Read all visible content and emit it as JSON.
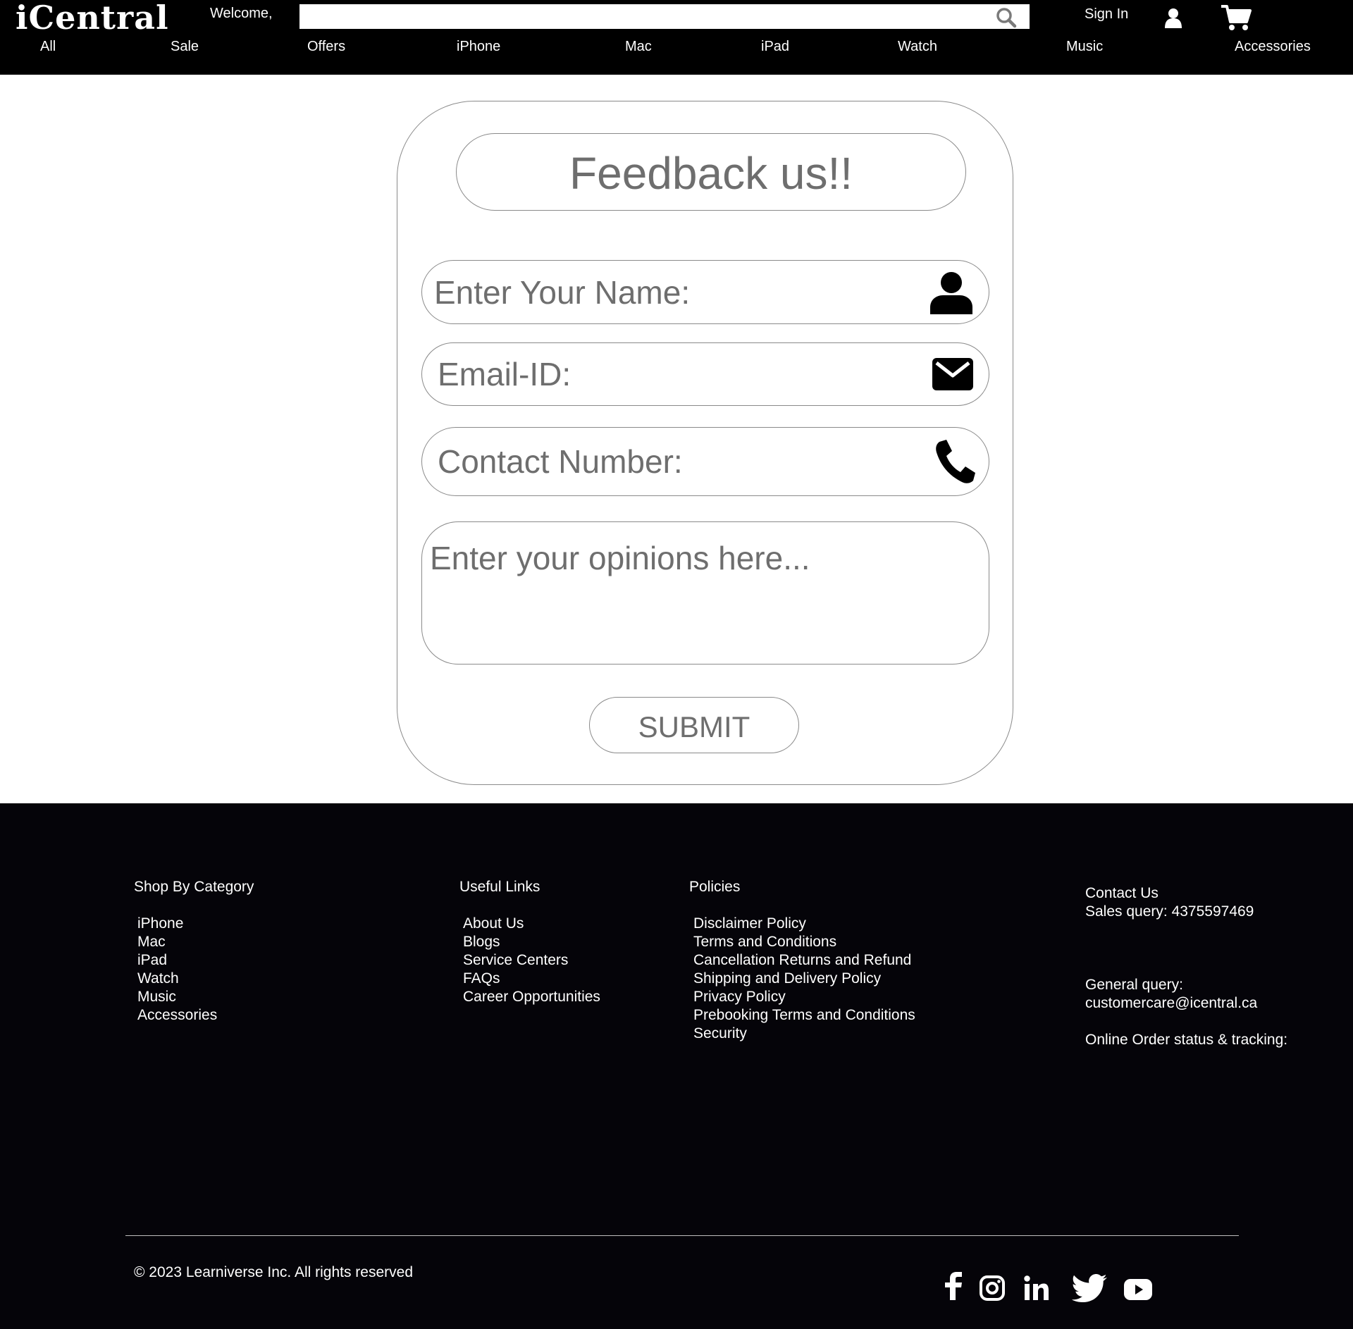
{
  "header": {
    "logo": "iCentral",
    "welcome": "Welcome,",
    "search_value": "",
    "sign_in": "Sign In"
  },
  "nav": [
    "All",
    "Sale",
    "Offers",
    "iPhone",
    "Mac",
    "iPad",
    "Watch",
    "Music",
    "Accessories"
  ],
  "form": {
    "title": "Feedback us!!",
    "name_placeholder": "Enter Your Name:",
    "email_placeholder": "Email-ID:",
    "phone_placeholder": "Contact Number:",
    "opinion_placeholder": "Enter your opinions here...",
    "submit": "SUBMIT"
  },
  "footer": {
    "shop": {
      "heading": "Shop By Category",
      "items": [
        "iPhone",
        "Mac",
        "iPad",
        "Watch",
        "Music",
        "Accessories"
      ]
    },
    "links": {
      "heading": "Useful Links",
      "items": [
        "About Us",
        "Blogs",
        "Service Centers",
        "FAQs",
        "Career Opportunities"
      ]
    },
    "policies": {
      "heading": "Policies",
      "items": [
        "Disclaimer Policy",
        "Terms and Conditions",
        "Cancellation Returns and Refund",
        "Shipping and Delivery Policy",
        "Privacy Policy",
        "Prebooking Terms and Conditions",
        "Security"
      ]
    },
    "contact": {
      "heading": "Contact Us",
      "sales": "Sales query: 4375597469",
      "general_label": "General query:",
      "general_email": "customercare@icentral.ca",
      "tracking": "Online Order status & tracking:"
    },
    "copyright": "© 2023 Learniverse Inc. All rights reserved",
    "social": [
      "facebook-icon",
      "instagram-icon",
      "linkedin-icon",
      "twitter-icon",
      "youtube-icon"
    ]
  },
  "colors": {
    "header_bg": "#000000",
    "footer_bg": "#050409",
    "form_text": "#6e6e6e",
    "form_border": "#8a8a8a"
  }
}
